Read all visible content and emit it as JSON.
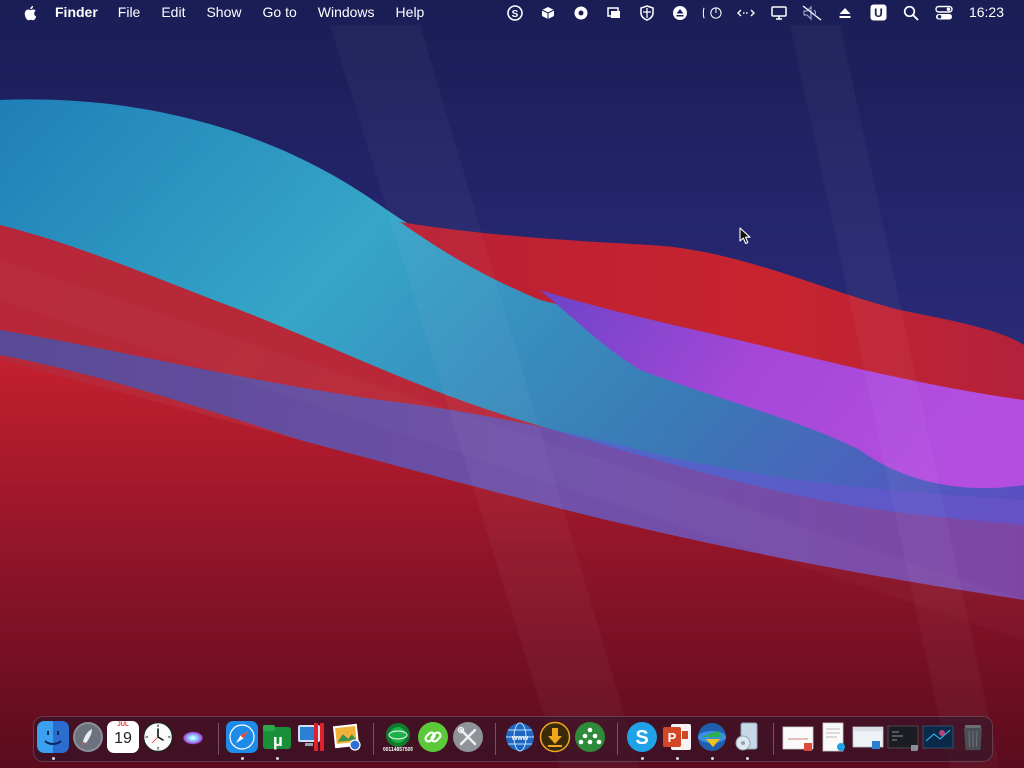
{
  "menubar": {
    "app_name": "Finder",
    "items": [
      "File",
      "Edit",
      "Show",
      "Go to",
      "Windows",
      "Help"
    ],
    "clock": "16:23",
    "status_icons": [
      "skype-icon",
      "box-icon",
      "gear-shield-icon",
      "stack-icon",
      "shield-icon",
      "eject-circle-icon",
      "power-icon",
      "network-arrows-icon",
      "display-icon",
      "mute-icon",
      "eject-icon",
      "u-badge-icon",
      "search-icon",
      "control-center-icon"
    ]
  },
  "dock": {
    "apps": [
      {
        "name": "finder-icon",
        "running": true
      },
      {
        "name": "launchpad-icon",
        "running": false
      },
      {
        "name": "calendar-icon",
        "running": false,
        "day": "19"
      },
      {
        "name": "clock-icon",
        "running": false
      },
      {
        "name": "siri-icon",
        "running": false
      },
      {
        "name": "safari-icon",
        "running": true
      },
      {
        "name": "utorrent-icon",
        "running": true
      },
      {
        "name": "parallels-icon",
        "running": false
      },
      {
        "name": "preview-icon",
        "running": false
      },
      {
        "name": "vpn-icon",
        "running": false
      },
      {
        "name": "link-icon",
        "running": false
      },
      {
        "name": "tools-icon",
        "running": false
      },
      {
        "name": "globe-icon",
        "running": false
      },
      {
        "name": "download-icon",
        "running": false
      },
      {
        "name": "rain-icon",
        "running": false
      },
      {
        "name": "skype-icon",
        "running": true
      },
      {
        "name": "powerpoint-icon",
        "running": true
      },
      {
        "name": "idm-icon",
        "running": true
      },
      {
        "name": "installer-icon",
        "running": true
      },
      {
        "name": "document-icon",
        "running": false
      },
      {
        "name": "document-icon",
        "running": false
      },
      {
        "name": "window-icon",
        "running": false
      },
      {
        "name": "terminal-icon",
        "running": false
      },
      {
        "name": "screenshot-icon",
        "running": false
      },
      {
        "name": "trash-icon",
        "running": false
      }
    ]
  },
  "colors": {
    "wallpaper_top": "#1c1f5c",
    "wave_teal": "#2fa0c8",
    "wave_red": "#c0232f",
    "wave_purple": "#a243d6",
    "wave_dark_red": "#6b0d22"
  }
}
